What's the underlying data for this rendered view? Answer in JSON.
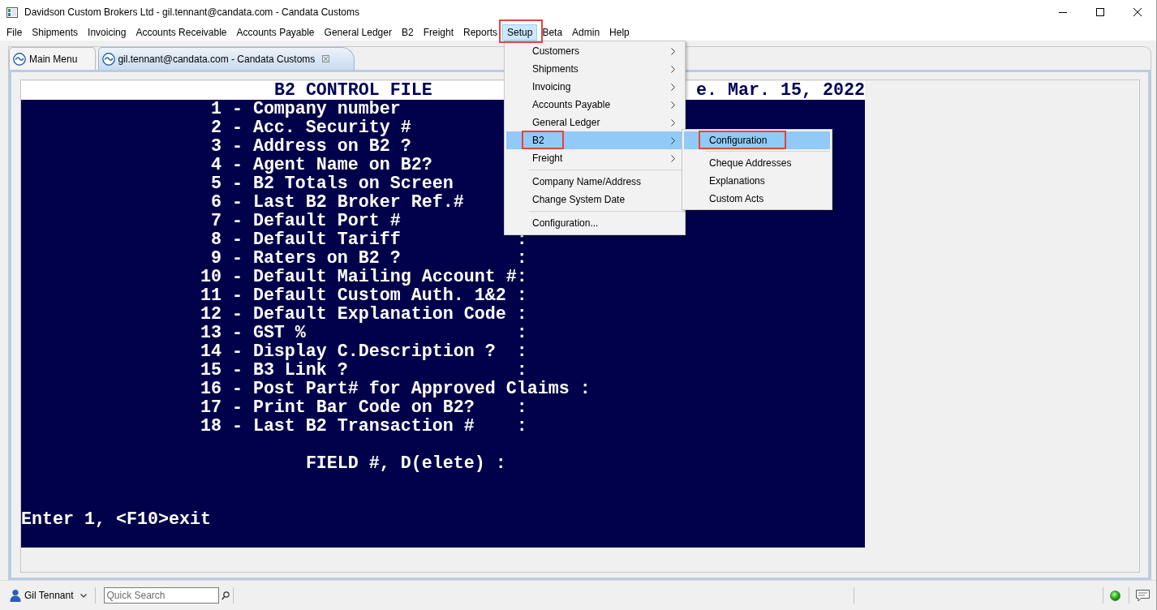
{
  "window": {
    "title": "Davidson Custom Brokers Ltd - gil.tennant@candata.com - Candata Customs"
  },
  "menu_bar": [
    {
      "label": "File",
      "selected": false,
      "outlined": false
    },
    {
      "label": "Shipments",
      "selected": false,
      "outlined": false
    },
    {
      "label": "Invoicing",
      "selected": false,
      "outlined": false
    },
    {
      "label": "Accounts Receivable",
      "selected": false,
      "outlined": false
    },
    {
      "label": "Accounts Payable",
      "selected": false,
      "outlined": false
    },
    {
      "label": "General Ledger",
      "selected": false,
      "outlined": false
    },
    {
      "label": "B2",
      "selected": false,
      "outlined": false
    },
    {
      "label": "Freight",
      "selected": false,
      "outlined": false
    },
    {
      "label": "Reports",
      "selected": false,
      "outlined": false
    },
    {
      "label": "Setup",
      "selected": true,
      "outlined": true,
      "menu": [
        {
          "kind": "item",
          "label": "Customers",
          "arrow": true,
          "selected": false,
          "outlined": false
        },
        {
          "kind": "item",
          "label": "Shipments",
          "arrow": true,
          "selected": false,
          "outlined": false
        },
        {
          "kind": "item",
          "label": "Invoicing",
          "arrow": true,
          "selected": false,
          "outlined": false
        },
        {
          "kind": "item",
          "label": "Accounts Payable",
          "arrow": true,
          "selected": false,
          "outlined": false
        },
        {
          "kind": "item",
          "label": "General Ledger",
          "arrow": true,
          "selected": false,
          "outlined": false
        },
        {
          "kind": "item",
          "label": "B2",
          "arrow": true,
          "selected": true,
          "outlined": true,
          "submenu": [
            {
              "kind": "item",
              "label": "Configuration",
              "arrow": false,
              "selected": true,
              "outlined": true
            },
            {
              "kind": "separator"
            },
            {
              "kind": "item",
              "label": "Cheque Addresses",
              "arrow": false,
              "selected": false,
              "outlined": false
            },
            {
              "kind": "item",
              "label": "Explanations",
              "arrow": false,
              "selected": false,
              "outlined": false
            },
            {
              "kind": "item",
              "label": "Custom Acts",
              "arrow": false,
              "selected": false,
              "outlined": false
            }
          ]
        },
        {
          "kind": "item",
          "label": "Freight",
          "arrow": true,
          "selected": false,
          "outlined": false
        },
        {
          "kind": "separator"
        },
        {
          "kind": "item",
          "label": "Company Name/Address",
          "arrow": false,
          "selected": false,
          "outlined": false
        },
        {
          "kind": "item",
          "label": "Change System Date",
          "arrow": false,
          "selected": false,
          "outlined": false
        },
        {
          "kind": "separator"
        },
        {
          "kind": "item",
          "label": "Configuration...",
          "arrow": false,
          "selected": false,
          "outlined": false
        }
      ]
    },
    {
      "label": "Beta",
      "selected": false,
      "outlined": false
    },
    {
      "label": "Admin",
      "selected": false,
      "outlined": false
    },
    {
      "label": "Help",
      "selected": false,
      "outlined": false
    }
  ],
  "tabs": [
    {
      "label": "Main Menu",
      "selected": false,
      "closable": false
    },
    {
      "label": "gil.tennant@candata.com - Candata Customs",
      "selected": true,
      "closable": true
    }
  ],
  "terminal": {
    "title": "B2 CONTROL FILE",
    "date": "e. Mar. 15, 2022",
    "fields": [
      {
        "number": "1",
        "text": "- Company number"
      },
      {
        "number": "2",
        "text": "- Acc. Security #"
      },
      {
        "number": "3",
        "text": "- Address on B2 ?"
      },
      {
        "number": "4",
        "text": "- Agent Name on B2?"
      },
      {
        "number": "5",
        "text": "- B2 Totals on Screen"
      },
      {
        "number": "6",
        "text": "- Last B2 Broker Ref.#"
      },
      {
        "number": "7",
        "text": "- Default Port #"
      },
      {
        "number": "8",
        "text": "- Default Tariff           :"
      },
      {
        "number": "9",
        "text": "- Raters on B2 ?           :"
      },
      {
        "number": "10",
        "text": "- Default Mailing Account #:"
      },
      {
        "number": "11",
        "text": "- Default Custom Auth. 1&2 :"
      },
      {
        "number": "12",
        "text": "- Default Explanation Code :"
      },
      {
        "number": "13",
        "text": "- GST %                    :"
      },
      {
        "number": "14",
        "text": "- Display C.Description ?  :"
      },
      {
        "number": "15",
        "text": "- B3 Link ?                :"
      },
      {
        "number": "16",
        "text": "- Post Part# for Approved Claims :"
      },
      {
        "number": "17",
        "text": "- Print Bar Code on B2?    :"
      },
      {
        "number": "18",
        "text": "- Last B2 Transaction #    :"
      }
    ],
    "prompt": "FIELD #, D(elete) :",
    "help": "Enter 1, <F10>exit"
  },
  "status_bar": {
    "user": "Gil Tennant",
    "search": {
      "placeholder": "Quick Search"
    }
  }
}
